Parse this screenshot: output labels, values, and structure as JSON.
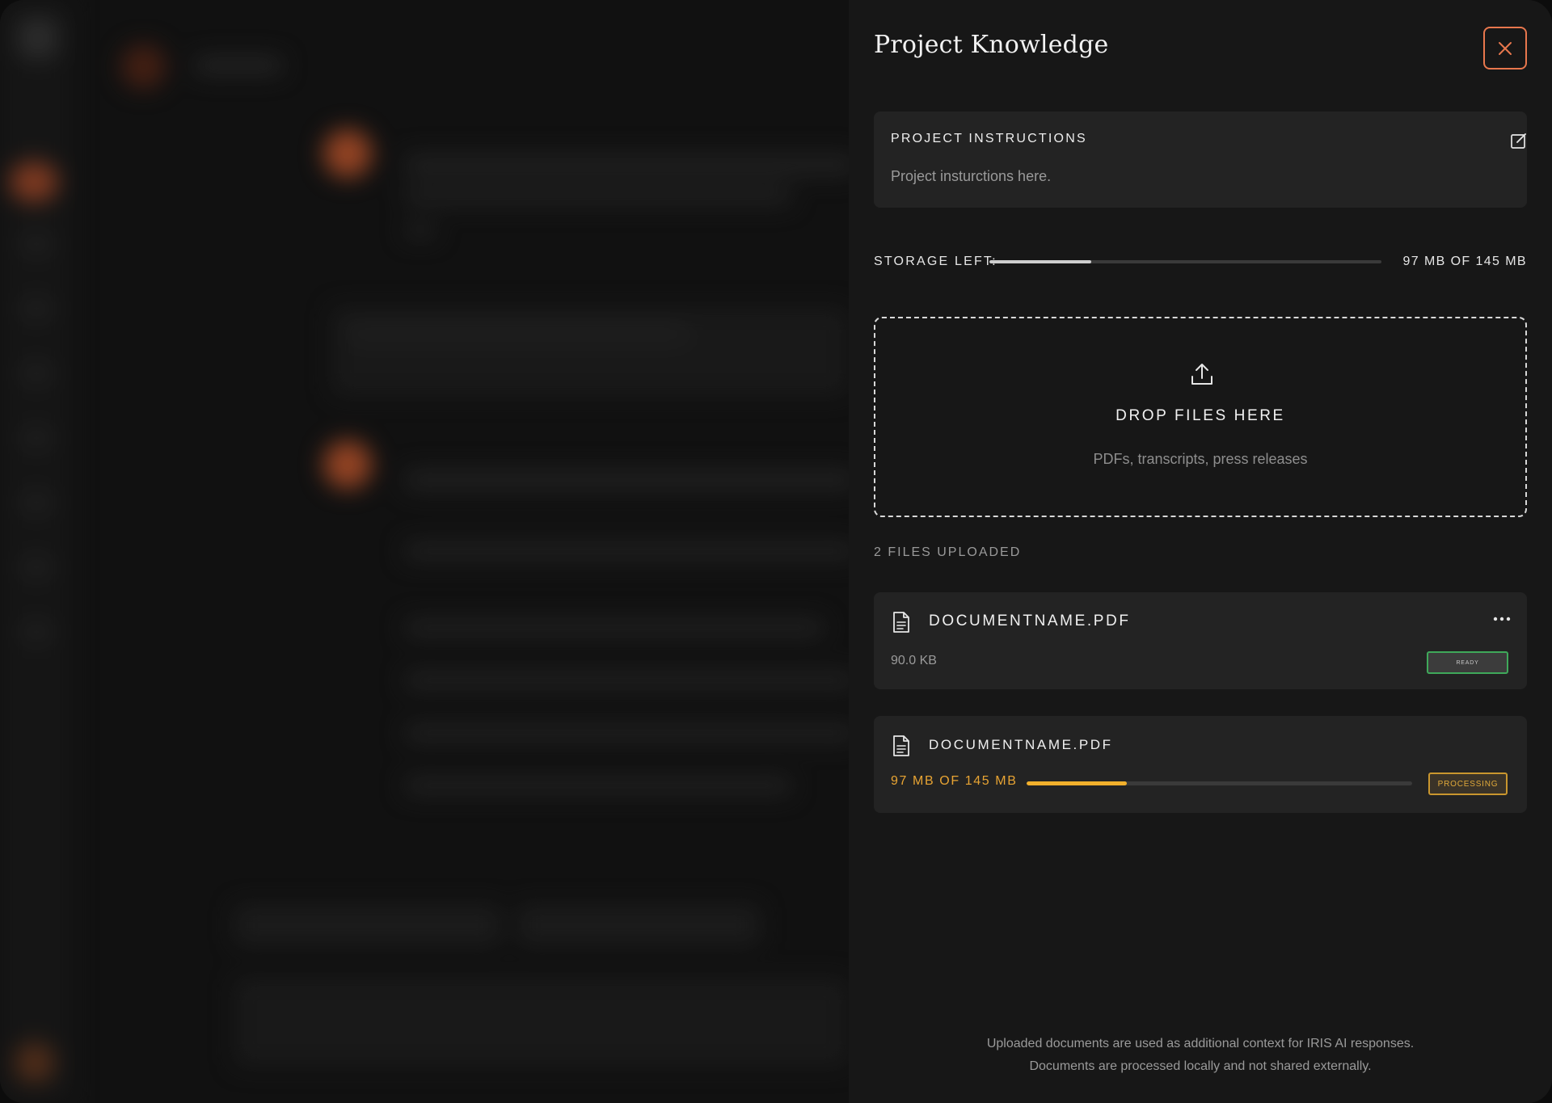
{
  "panel": {
    "title": "Project Knowledge",
    "close_icon": "close-icon"
  },
  "instructions": {
    "label": "PROJECT INSTRUCTIONS",
    "text": "Project insturctions here.",
    "edit_icon": "edit-icon"
  },
  "storage": {
    "label": "STORAGE LEFT:",
    "value": "97 MB OF 145 MB",
    "used_fraction": 0.26
  },
  "dropzone": {
    "title": "DROP FILES HERE",
    "subtitle": "PDFs, transcripts, press releases",
    "icon": "upload-icon"
  },
  "files": {
    "count_label": "2 FILES UPLOADED",
    "items": [
      {
        "name": "DOCUMENTNAME.PDF",
        "size": "90.0 KB",
        "status": "READY",
        "status_color": "#3fa85a",
        "icon": "document-icon",
        "menu_icon": "more-horizontal-icon"
      },
      {
        "name": "DOCUMENTNAME.PDF",
        "progress_label": "97 MB OF 145 MB",
        "progress_fraction": 0.26,
        "status": "PROCESSING",
        "status_color": "#c9962e",
        "icon": "document-icon"
      }
    ]
  },
  "footer": {
    "line1": "Uploaded documents are used as additional context for IRIS AI responses.",
    "line2": "Documents are processed locally and not shared externally."
  },
  "colors": {
    "accent": "#e8774d",
    "progress": "#f2b02c",
    "panel_bg": "#171717",
    "card_bg": "#232323"
  }
}
